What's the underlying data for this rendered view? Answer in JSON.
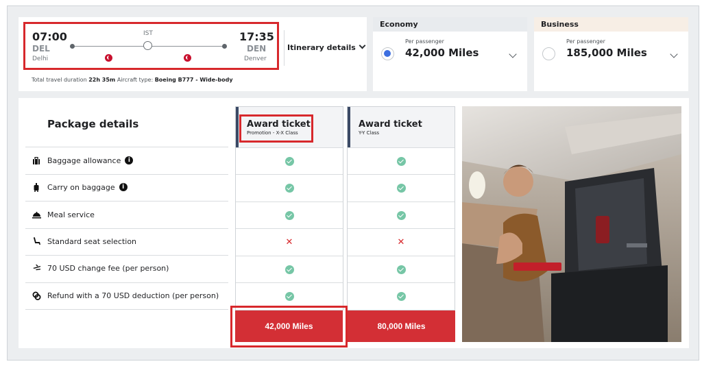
{
  "flight": {
    "depart_time": "07:00",
    "depart_code": "DEL",
    "depart_city": "Delhi",
    "arrive_time": "17:35",
    "arrive_code": "DEN",
    "arrive_city": "Denver",
    "stopover": "IST",
    "itinerary_label": "Itinerary details",
    "duration_label": "Total travel duration",
    "duration_value": "22h 35m",
    "aircraft_label": "Aircraft type:",
    "aircraft_value": "Boeing B777 - Wide-body"
  },
  "fares": {
    "economy": {
      "name": "Economy",
      "per_passenger": "Per passenger",
      "miles": "42,000 Miles",
      "selected": true
    },
    "business": {
      "name": "Business",
      "per_passenger": "Per passenger",
      "miles": "185,000 Miles",
      "selected": false
    }
  },
  "package": {
    "title": "Package details",
    "features": [
      {
        "label": "Baggage allowance",
        "icon": "suitcase-icon",
        "info": true
      },
      {
        "label": "Carry on baggage",
        "icon": "carry-on-icon",
        "info": true
      },
      {
        "label": "Meal service",
        "icon": "meal-icon",
        "info": false
      },
      {
        "label": "Standard seat selection",
        "icon": "seat-icon",
        "info": false
      },
      {
        "label": "70 USD change fee (per person)",
        "icon": "change-fee-icon",
        "info": false
      },
      {
        "label": "Refund with a 70 USD deduction (per person)",
        "icon": "refund-icon",
        "info": false
      }
    ],
    "columns": [
      {
        "title": "Award ticket",
        "subtitle": "Promotion - X-X Class",
        "price": "42,000 Miles",
        "included": [
          true,
          true,
          true,
          false,
          true,
          true
        ]
      },
      {
        "title": "Award ticket",
        "subtitle": "Y-Y Class",
        "price": "80,000 Miles",
        "included": [
          true,
          true,
          true,
          false,
          true,
          true
        ]
      }
    ]
  },
  "colors": {
    "brand_red": "#d32f35",
    "check_green": "#76c6a6",
    "radio_blue": "#3d6fe0"
  }
}
